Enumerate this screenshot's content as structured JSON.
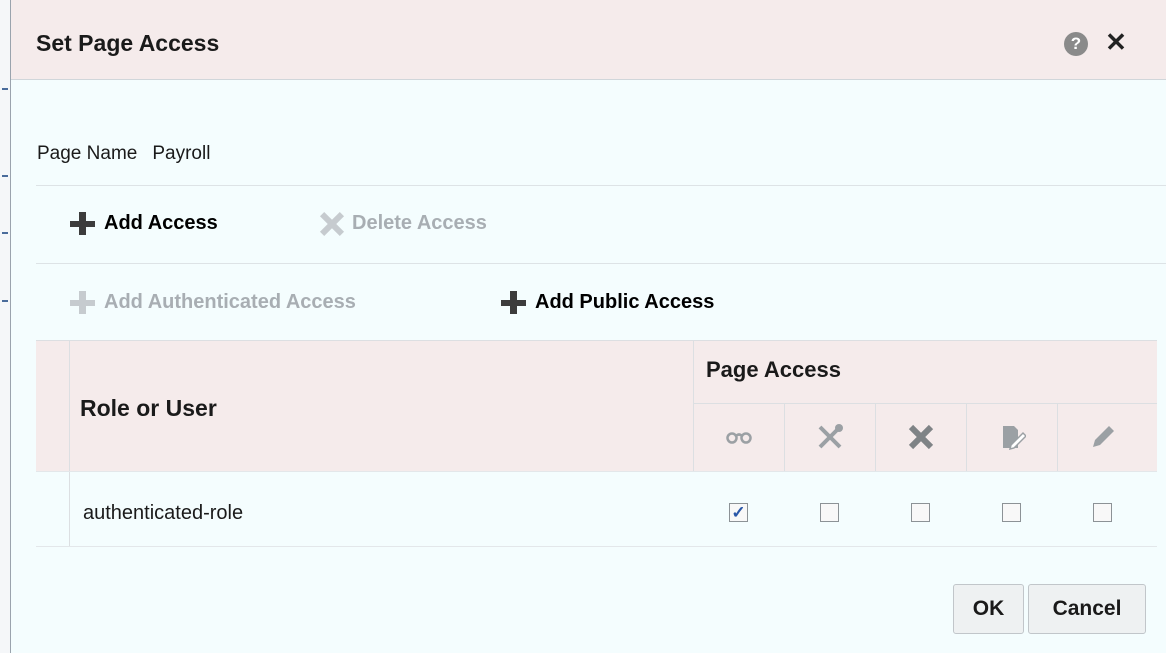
{
  "dialog": {
    "title": "Set Page Access",
    "help_icon": "help-icon",
    "close_icon": "close-icon",
    "close_glyph": "✕",
    "help_glyph": "?"
  },
  "page_name": {
    "label": "Page Name",
    "value": "Payroll"
  },
  "toolbar1": {
    "add_access": {
      "label": "Add Access",
      "icon": "plus-icon",
      "enabled": true
    },
    "delete_access": {
      "label": "Delete Access",
      "icon": "delete-x-icon",
      "enabled": false
    }
  },
  "toolbar2": {
    "add_authenticated_access": {
      "label": "Add Authenticated Access",
      "icon": "plus-icon",
      "enabled": false
    },
    "add_public_access": {
      "label": "Add Public Access",
      "icon": "plus-icon",
      "enabled": true
    }
  },
  "table": {
    "col_role": "Role or User",
    "col_page_access": "Page Access",
    "permission_columns": [
      {
        "name": "view",
        "icon": "view-glasses-icon",
        "glyph": "⌓"
      },
      {
        "name": "customize",
        "icon": "customize-tools-icon",
        "glyph": "⚒"
      },
      {
        "name": "delete",
        "icon": "delete-x-icon",
        "glyph": "✕"
      },
      {
        "name": "update",
        "icon": "update-doc-icon",
        "glyph": "✎"
      },
      {
        "name": "edit",
        "icon": "edit-pencil-icon",
        "glyph": "✏"
      }
    ],
    "rows": [
      {
        "role": "authenticated-role",
        "permissions": [
          true,
          false,
          false,
          false,
          false
        ]
      }
    ]
  },
  "buttons": {
    "ok": "OK",
    "cancel": "Cancel"
  }
}
